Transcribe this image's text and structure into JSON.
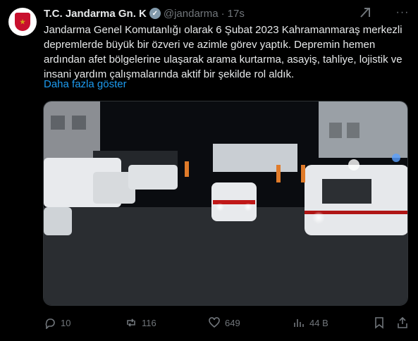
{
  "post": {
    "author_name": "T.C. Jandarma Gn. K",
    "verified_icon": "verified-badge-icon",
    "handle": "@jandarma",
    "separator": "·",
    "time": "17s",
    "text": "Jandarma Genel Komutanlığı olarak 6 Şubat 2023 Kahramanmaraş merkezli depremlerde büyük bir özveri ve azimle görev yaptık. Depremin hemen ardından afet bölgelerine ulaşarak arama kurtarma, asayiş, tahliye, lojistik ve insani yardım çalışmalarında aktif bir şekilde rol aldık.",
    "show_more": "Daha fazla göster",
    "media_alt_icon": "video-thumbnail"
  },
  "actions": {
    "replies": "10",
    "reposts": "116",
    "likes": "649",
    "views": "44 B"
  },
  "colors": {
    "link": "#1d9bf0",
    "muted": "#71767b",
    "text": "#e7e9ea",
    "background": "#000000"
  }
}
